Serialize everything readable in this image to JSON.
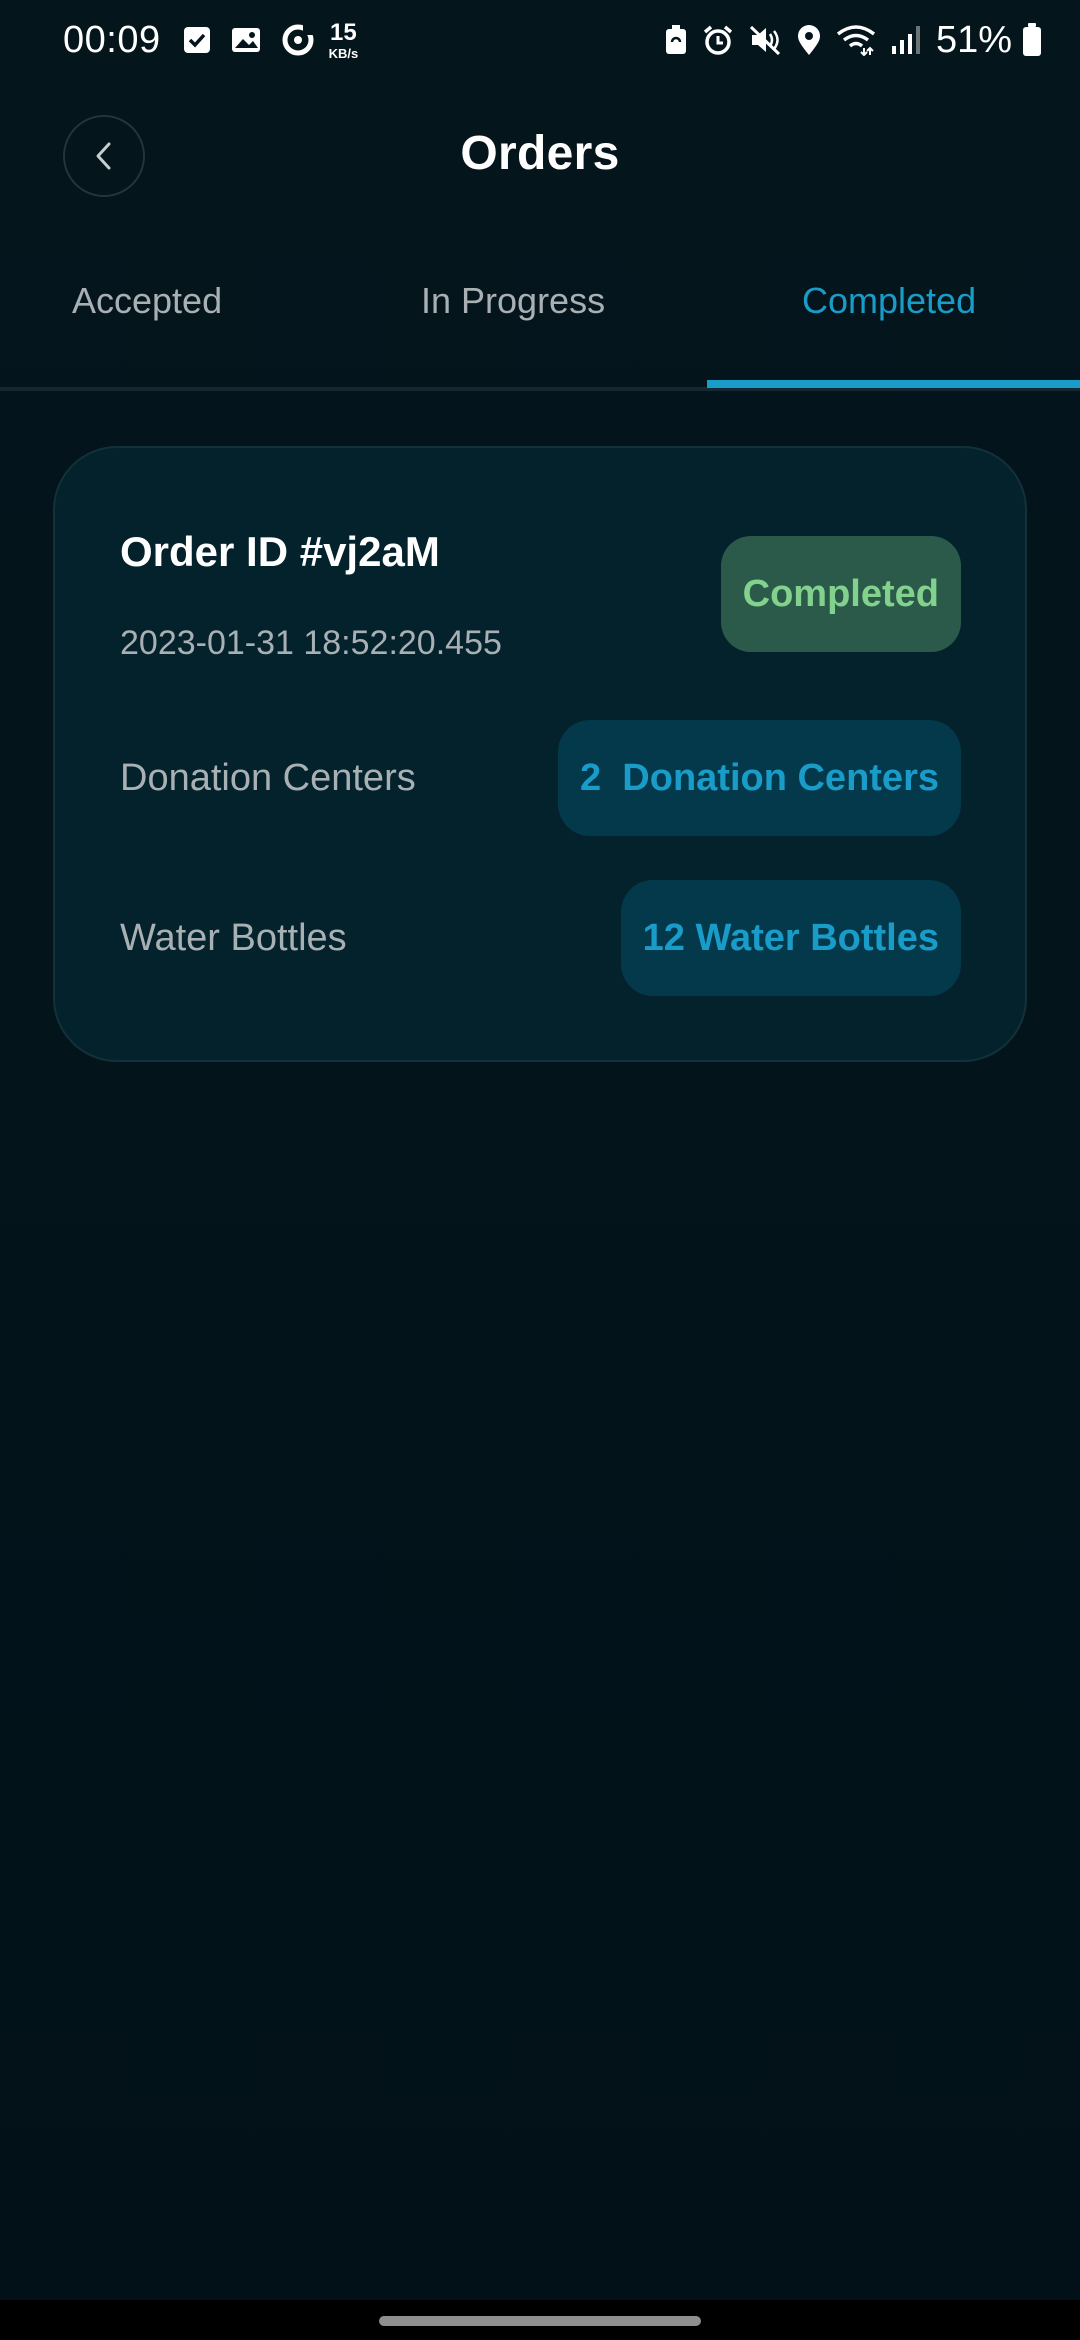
{
  "status_bar": {
    "time": "00:09",
    "net_speed_value": "15",
    "net_speed_unit": "KB/s",
    "battery_percent": "51%",
    "icons_left": [
      "checkbox-icon",
      "image-icon",
      "sync-icon"
    ],
    "icons_right": [
      "battery-saver-icon",
      "alarm-icon",
      "mute-icon",
      "location-icon",
      "wifi-icon",
      "signal-icon",
      "battery-icon"
    ]
  },
  "header": {
    "title": "Orders",
    "back_icon": "chevron-left-icon"
  },
  "tabs": [
    {
      "label": "Accepted",
      "active": false
    },
    {
      "label": "In Progress",
      "active": false
    },
    {
      "label": "Completed",
      "active": true
    }
  ],
  "order": {
    "id_text": "Order ID #vj2aM",
    "timestamp": "2023-01-31 18:52:20.455",
    "status": "Completed",
    "rows": [
      {
        "label": "Donation Centers",
        "value": "2  Donation Centers"
      },
      {
        "label": "Water Bottles",
        "value": "12 Water Bottles"
      }
    ]
  },
  "colors": {
    "accent": "#1a9cc9",
    "completed_text": "#82d28e",
    "completed_bg": "#2b5a4a",
    "card_bg": "#03222c",
    "background": "#03141b"
  }
}
